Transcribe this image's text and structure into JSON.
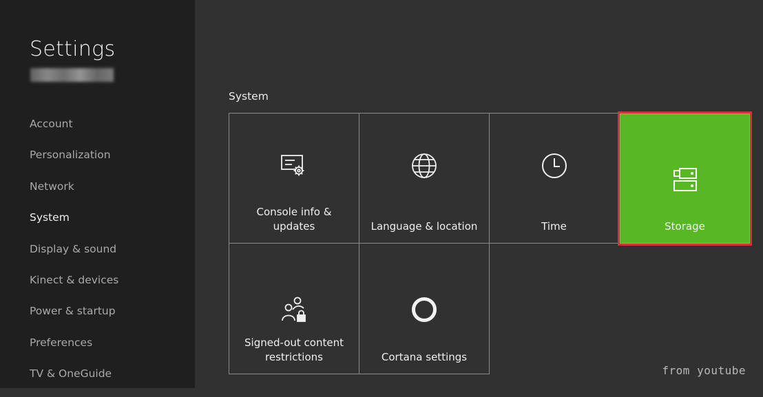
{
  "app": {
    "title": "Settings"
  },
  "sidebar": {
    "items": [
      {
        "label": "Account",
        "active": false
      },
      {
        "label": "Personalization",
        "active": false
      },
      {
        "label": "Network",
        "active": false
      },
      {
        "label": "System",
        "active": true
      },
      {
        "label": "Display & sound",
        "active": false
      },
      {
        "label": "Kinect & devices",
        "active": false
      },
      {
        "label": "Power & startup",
        "active": false
      },
      {
        "label": "Preferences",
        "active": false
      },
      {
        "label": "TV & OneGuide",
        "active": false
      }
    ]
  },
  "main": {
    "section_label": "System",
    "tiles": [
      {
        "label": "Console info &\nupdates",
        "icon": "console-info-icon",
        "selected": false
      },
      {
        "label": "Language & location",
        "icon": "globe-icon",
        "selected": false
      },
      {
        "label": "Time",
        "icon": "clock-icon",
        "selected": false
      },
      {
        "label": "Storage",
        "icon": "storage-icon",
        "selected": true
      },
      {
        "label": "Signed-out content\nrestrictions",
        "icon": "people-lock-icon",
        "selected": false
      },
      {
        "label": "Cortana settings",
        "icon": "cortana-ring-icon",
        "selected": false
      }
    ]
  },
  "watermark": "from youtube",
  "colors": {
    "sidebar_bg": "#1f1f1f",
    "main_bg": "#313131",
    "accent_green": "#58b824",
    "highlight_red": "#d8303a"
  }
}
